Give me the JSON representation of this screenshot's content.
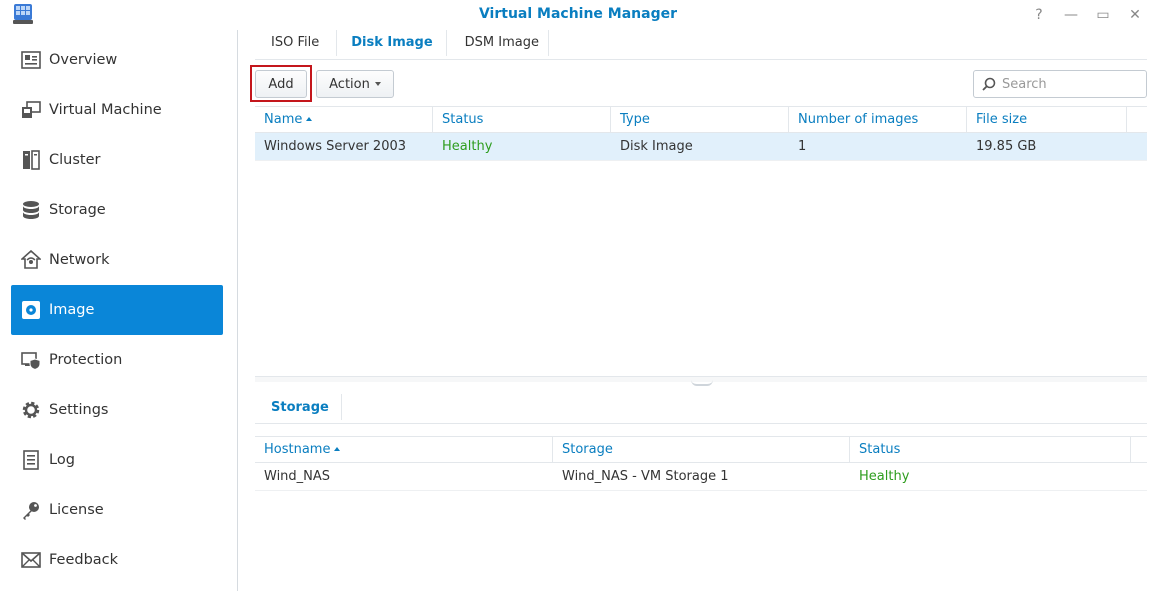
{
  "window": {
    "title": "Virtual Machine Manager",
    "controls": [
      {
        "name": "help-icon",
        "glyph": "?"
      },
      {
        "name": "minimize-icon",
        "glyph": "—"
      },
      {
        "name": "maximize-icon",
        "glyph": "▭"
      },
      {
        "name": "close-icon",
        "glyph": "✕"
      }
    ]
  },
  "sidebar": {
    "items": [
      {
        "label": "Overview",
        "icon": "overview-icon"
      },
      {
        "label": "Virtual Machine",
        "icon": "virtual-machine-icon"
      },
      {
        "label": "Cluster",
        "icon": "cluster-icon"
      },
      {
        "label": "Storage",
        "icon": "storage-icon"
      },
      {
        "label": "Network",
        "icon": "network-icon"
      },
      {
        "label": "Image",
        "icon": "image-icon",
        "active": true
      },
      {
        "label": "Protection",
        "icon": "protection-icon"
      },
      {
        "label": "Settings",
        "icon": "gear-icon"
      },
      {
        "label": "Log",
        "icon": "log-icon"
      },
      {
        "label": "License",
        "icon": "key-icon"
      },
      {
        "label": "Feedback",
        "icon": "envelope-icon"
      }
    ]
  },
  "tabs": [
    {
      "label": "ISO File"
    },
    {
      "label": "Disk Image",
      "active": true
    },
    {
      "label": "DSM Image"
    }
  ],
  "toolbar": {
    "add_label": "Add",
    "action_label": "Action",
    "search_placeholder": "Search"
  },
  "images_table": {
    "columns": [
      "Name",
      "Status",
      "Type",
      "Number of images",
      "File size"
    ],
    "rows": [
      {
        "name": "Windows Server 2003",
        "status": "Healthy",
        "type": "Disk Image",
        "count": "1",
        "size": "19.85 GB"
      }
    ]
  },
  "storage_tab": {
    "label": "Storage"
  },
  "storage_table": {
    "columns": [
      "Hostname",
      "Storage",
      "Status"
    ],
    "rows": [
      {
        "hostname": "Wind_NAS",
        "storage": "Wind_NAS - VM Storage 1",
        "status": "Healthy"
      }
    ]
  },
  "colors": {
    "accent": "#0a7ec0",
    "active_bg": "#0a86d8",
    "healthy": "#2e9d1e",
    "highlight": "#c4161c"
  }
}
